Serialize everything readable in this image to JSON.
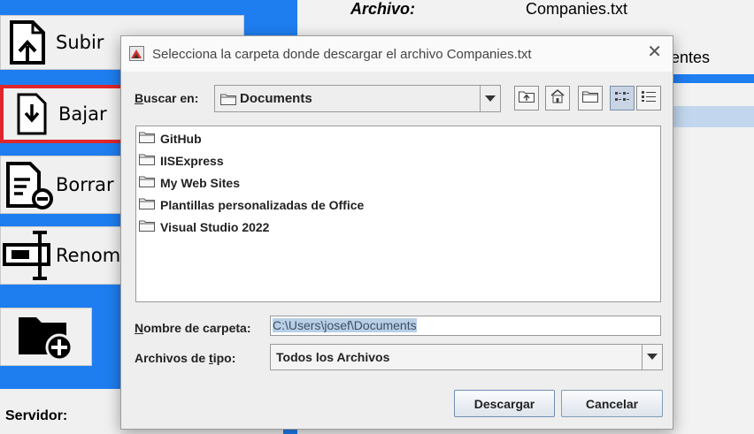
{
  "app": {
    "left_buttons": [
      {
        "label": "Subir"
      },
      {
        "label": "Bajar"
      },
      {
        "label": "Borrar"
      },
      {
        "label": "Renombrar"
      },
      {
        "label": ""
      }
    ],
    "servidor_label": "Servidor:",
    "archivo_label": "Archivo:",
    "archivo_value": "Companies.txt",
    "partial_label": "entes",
    "colors": {
      "blue": "#1e7ef0",
      "selected_border": "#e0262b"
    }
  },
  "dialog": {
    "title": "Selecciona la carpeta donde descargar el archivo Companies.txt",
    "close_glyph": "✕",
    "look_in_label_first": "B",
    "look_in_label_rest": "uscar en:",
    "look_in_value": "Documents",
    "toolbar": [
      {
        "name": "up-one-level-icon"
      },
      {
        "name": "home-icon"
      },
      {
        "name": "new-folder-icon"
      },
      {
        "name": "list-view-icon",
        "pressed": true
      },
      {
        "name": "details-view-icon",
        "pressed": false
      }
    ],
    "folders": [
      "GitHub",
      "IISExpress",
      "My Web Sites",
      "Plantillas personalizadas de Office",
      "Visual Studio 2022"
    ],
    "folder_name_label_first": "N",
    "folder_name_label_rest": "ombre de carpeta:",
    "folder_name_value": "C:\\Users\\josef\\Documents",
    "file_type_label_pre": "Archivos de ",
    "file_type_label_underlined": "t",
    "file_type_label_post": "ipo:",
    "file_type_value": "Todos los Archivos",
    "download_button": "Descargar",
    "cancel_button": "Cancelar"
  }
}
